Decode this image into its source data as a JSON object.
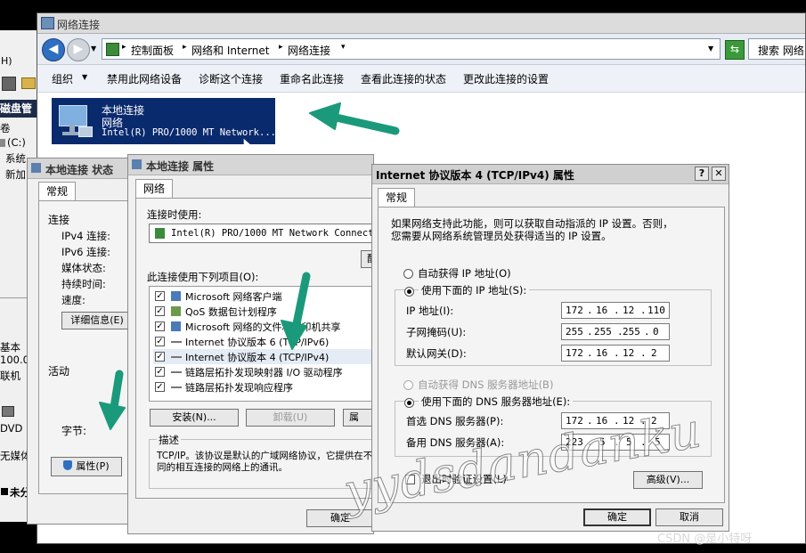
{
  "explorer": {
    "title": "网络连接",
    "breadcrumb": [
      "控制面板",
      "网络和 Internet",
      "网络连接"
    ],
    "search_placeholder": "搜索 网络",
    "toolbar": [
      "组织",
      "禁用此网络设备",
      "诊断这个连接",
      "重命名此连接",
      "查看此连接的状态",
      "更改此连接的设置"
    ],
    "connection": {
      "name": "本地连接",
      "type": "网络",
      "adapter": "Intel(R) PRO/1000 MT Network..."
    }
  },
  "disk_window": {
    "menu_fragment": "H)",
    "panel_title": "磁盘管",
    "volume_label": "卷",
    "volume_c": "(C:)",
    "items": [
      "系统",
      "新加"
    ],
    "bottom": [
      "基本",
      "100.0",
      "联机",
      "DVD (",
      "无媒体"
    ],
    "status": "未分"
  },
  "status_window": {
    "title": "本地连接 状态",
    "tab": "常规",
    "section_connection": "连接",
    "fields": [
      "IPv4 连接:",
      "IPv6 连接:",
      "媒体状态:",
      "持续时间:",
      "速度:"
    ],
    "details_button": "详细信息(E)",
    "section_activity": "活动",
    "bytes_label": "字节:",
    "properties_button": "属性(P)"
  },
  "props_window": {
    "title": "本地连接 属性",
    "tab": "网络",
    "connect_using_label": "连接时使用:",
    "adapter": "Intel(R) PRO/1000 MT Network Connection",
    "configure_button": "配",
    "items_label": "此连接使用下列项目(O):",
    "items": [
      "Microsoft 网络客户端",
      "QoS 数据包计划程序",
      "Microsoft 网络的文件和打印机共享",
      "Internet 协议版本 6 (TCP/IPv6)",
      "Internet 协议版本 4 (TCP/IPv4)",
      "链路层拓扑发现映射器 I/O 驱动程序",
      "链路层拓扑发现响应程序"
    ],
    "install_button": "安装(N)...",
    "uninstall_button": "卸载(U)",
    "props_fragment_button": "属",
    "description_label": "描述",
    "description_text": "TCP/IP。该协议是默认的广域网络协议，它提供在不同的相互连接的网络上的通讯。",
    "ok_button": "确定"
  },
  "ipv4_dialog": {
    "title": "Internet 协议版本 4 (TCP/IPv4) 属性",
    "help_glyph": "?",
    "close_glyph": "✕",
    "tab": "常规",
    "intro": [
      "如果网络支持此功能，则可以获取自动指派的 IP 设置。否则，",
      "您需要从网络系统管理员处获得适当的 IP 设置。"
    ],
    "auto_ip": "自动获得 IP 地址(O)",
    "manual_ip": "使用下面的 IP 地址(S):",
    "ip_label": "IP 地址(I):",
    "ip_value": [
      "172",
      "16",
      "12",
      "110"
    ],
    "mask_label": "子网掩码(U):",
    "mask_value": [
      "255",
      "255",
      "255",
      "0"
    ],
    "gateway_label": "默认网关(D):",
    "gateway_value": [
      "172",
      "16",
      "12",
      "2"
    ],
    "auto_dns": "自动获得 DNS 服务器地址(B)",
    "manual_dns": "使用下面的 DNS 服务器地址(E):",
    "pref_dns_label": "首选 DNS 服务器(P):",
    "pref_dns_value": [
      "172",
      "16",
      "12",
      "2"
    ],
    "alt_dns_label": "备用 DNS 服务器(A):",
    "alt_dns_value": [
      "223",
      "5",
      "5",
      "5"
    ],
    "validate_label": "退出时验证设置(L)",
    "advanced_button": "高级(V)...",
    "ok_button": "确定",
    "cancel_button": "取消"
  },
  "watermark": "yydsdandanku",
  "csdn": "CSDN @是小特呀",
  "arrow_color": "#1a9a7a"
}
